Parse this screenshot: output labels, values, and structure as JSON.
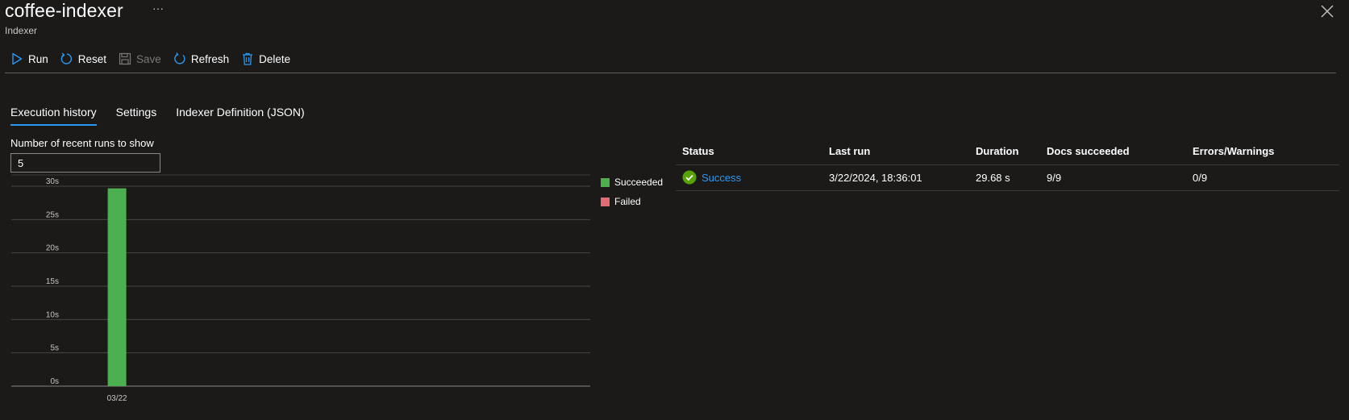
{
  "header": {
    "title": "coffee-indexer",
    "more_label": "···",
    "subtitle": "Indexer"
  },
  "toolbar": {
    "run_label": "Run",
    "reset_label": "Reset",
    "save_label": "Save",
    "refresh_label": "Refresh",
    "delete_label": "Delete"
  },
  "tabs": [
    {
      "label": "Execution history",
      "active": true
    },
    {
      "label": "Settings",
      "active": false
    },
    {
      "label": "Indexer Definition (JSON)",
      "active": false
    }
  ],
  "runs_filter": {
    "label": "Number of recent runs to show",
    "value": "5"
  },
  "legend": {
    "succeeded": "Succeeded",
    "failed": "Failed"
  },
  "colors": {
    "succeeded": "#4caf50",
    "failed": "#e06c75",
    "accent": "#2899f5",
    "success_icon": "#57a300"
  },
  "chart_data": {
    "type": "bar",
    "categories": [
      "03/22"
    ],
    "series": [
      {
        "name": "Succeeded",
        "values": [
          29.68
        ]
      },
      {
        "name": "Failed",
        "values": [
          0
        ]
      }
    ],
    "yticks": [
      "0s",
      "5s",
      "10s",
      "15s",
      "20s",
      "25s",
      "30s"
    ],
    "ylim": [
      0,
      30
    ],
    "grid": true,
    "legend_position": "right"
  },
  "table": {
    "headers": [
      "Status",
      "Last run",
      "Duration",
      "Docs succeeded",
      "Errors/Warnings"
    ],
    "rows": [
      {
        "status": "Success",
        "status_icon": "check-circle-icon",
        "last_run": "3/22/2024, 18:36:01",
        "duration": "29.68 s",
        "docs_succeeded": "9/9",
        "errors_warnings": "0/9"
      }
    ]
  }
}
